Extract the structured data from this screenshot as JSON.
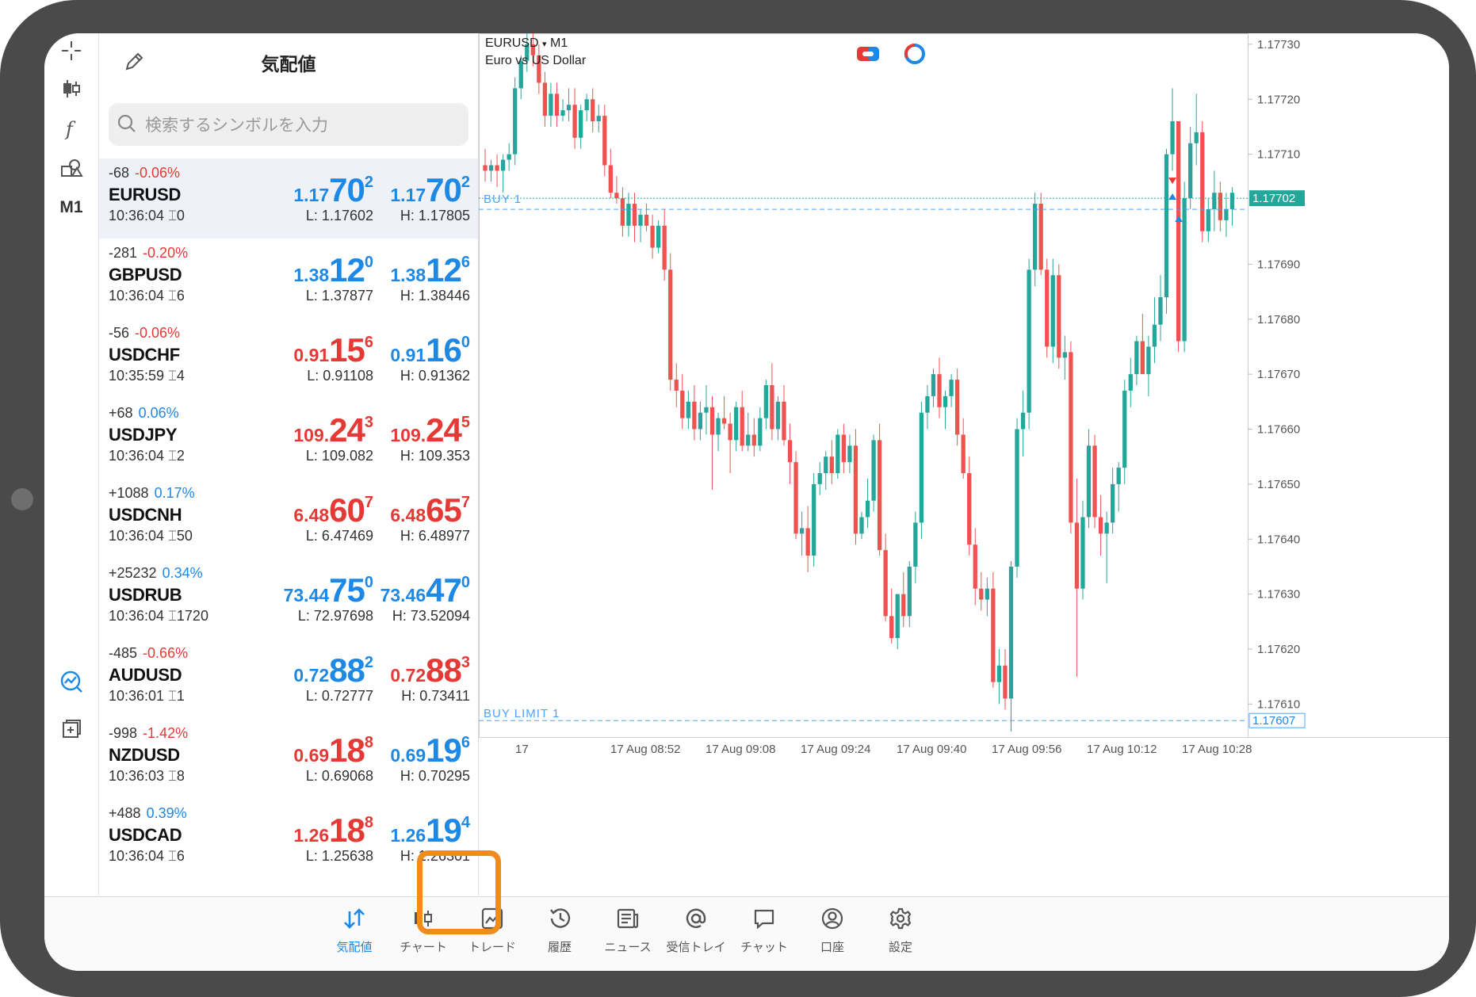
{
  "quotes": {
    "title": "気配値",
    "search_placeholder": "検索するシンボルを入力",
    "rows": [
      {
        "change": "-68",
        "pct": "-0.06%",
        "pct_color": "red",
        "symbol": "EURUSD",
        "time": "10:36:04",
        "spread": "0",
        "bid": {
          "small": "1.17",
          "big": "70",
          "sup": "2",
          "color": "blue"
        },
        "ask": {
          "small": "1.17",
          "big": "70",
          "sup": "2",
          "color": "blue"
        },
        "low": "L: 1.17602",
        "high": "H: 1.17805",
        "selected": true
      },
      {
        "change": "-281",
        "pct": "-0.20%",
        "pct_color": "red",
        "symbol": "GBPUSD",
        "time": "10:36:04",
        "spread": "6",
        "bid": {
          "small": "1.38",
          "big": "12",
          "sup": "0",
          "color": "blue"
        },
        "ask": {
          "small": "1.38",
          "big": "12",
          "sup": "6",
          "color": "blue"
        },
        "low": "L: 1.37877",
        "high": "H: 1.38446",
        "selected": false
      },
      {
        "change": "-56",
        "pct": "-0.06%",
        "pct_color": "red",
        "symbol": "USDCHF",
        "time": "10:35:59",
        "spread": "4",
        "bid": {
          "small": "0.91",
          "big": "15",
          "sup": "6",
          "color": "red"
        },
        "ask": {
          "small": "0.91",
          "big": "16",
          "sup": "0",
          "color": "blue"
        },
        "low": "L: 0.91108",
        "high": "H: 0.91362",
        "selected": false
      },
      {
        "change": "+68",
        "pct": "0.06%",
        "pct_color": "blue",
        "symbol": "USDJPY",
        "time": "10:36:04",
        "spread": "2",
        "bid": {
          "small": "109.",
          "big": "24",
          "sup": "3",
          "color": "red"
        },
        "ask": {
          "small": "109.",
          "big": "24",
          "sup": "5",
          "color": "red"
        },
        "low": "L: 109.082",
        "high": "H: 109.353",
        "selected": false
      },
      {
        "change": "+1088",
        "pct": "0.17%",
        "pct_color": "blue",
        "symbol": "USDCNH",
        "time": "10:36:04",
        "spread": "50",
        "bid": {
          "small": "6.48",
          "big": "60",
          "sup": "7",
          "color": "red"
        },
        "ask": {
          "small": "6.48",
          "big": "65",
          "sup": "7",
          "color": "red"
        },
        "low": "L: 6.47469",
        "high": "H: 6.48977",
        "selected": false
      },
      {
        "change": "+25232",
        "pct": "0.34%",
        "pct_color": "blue",
        "symbol": "USDRUB",
        "time": "10:36:04",
        "spread": "1720",
        "bid": {
          "small": "73.44",
          "big": "75",
          "sup": "0",
          "color": "blue"
        },
        "ask": {
          "small": "73.46",
          "big": "47",
          "sup": "0",
          "color": "blue"
        },
        "low": "L: 72.97698",
        "high": "H: 73.52094",
        "selected": false
      },
      {
        "change": "-485",
        "pct": "-0.66%",
        "pct_color": "red",
        "symbol": "AUDUSD",
        "time": "10:36:01",
        "spread": "1",
        "bid": {
          "small": "0.72",
          "big": "88",
          "sup": "2",
          "color": "blue"
        },
        "ask": {
          "small": "0.72",
          "big": "88",
          "sup": "3",
          "color": "red"
        },
        "low": "L: 0.72777",
        "high": "H: 0.73411",
        "selected": false
      },
      {
        "change": "-998",
        "pct": "-1.42%",
        "pct_color": "red",
        "symbol": "NZDUSD",
        "time": "10:36:03",
        "spread": "8",
        "bid": {
          "small": "0.69",
          "big": "18",
          "sup": "8",
          "color": "red"
        },
        "ask": {
          "small": "0.69",
          "big": "19",
          "sup": "6",
          "color": "blue"
        },
        "low": "L: 0.69068",
        "high": "H: 0.70295",
        "selected": false
      },
      {
        "change": "+488",
        "pct": "0.39%",
        "pct_color": "blue",
        "symbol": "USDCAD",
        "time": "10:36:04",
        "spread": "6",
        "bid": {
          "small": "1.26",
          "big": "18",
          "sup": "8",
          "color": "red"
        },
        "ask": {
          "small": "1.26",
          "big": "19",
          "sup": "4",
          "color": "blue"
        },
        "low": "L: 1.25638",
        "high": "H: 1.26301",
        "selected": false
      }
    ]
  },
  "tools": {
    "timeframe": "M1"
  },
  "chart": {
    "symbol_label": "EURUSD",
    "timeframe": "M1",
    "description": "Euro vs US Dollar",
    "buy_label": "BUY 1",
    "buy_limit_label": "BUY LIMIT 1",
    "current_price_label": "1.17702",
    "buy_limit_price_label": "1.17607"
  },
  "chart_data": {
    "type": "candlestick",
    "y_ticks": [
      "1.17730",
      "1.17720",
      "1.17710",
      "1.17690",
      "1.17680",
      "1.17670",
      "1.17660",
      "1.17650",
      "1.17640",
      "1.17630",
      "1.17620",
      "1.17610"
    ],
    "y_values": [
      1.1773,
      1.1772,
      1.1771,
      1.1769,
      1.1768,
      1.1767,
      1.1766,
      1.1765,
      1.1764,
      1.1763,
      1.1762,
      1.1761
    ],
    "ylim": [
      1.17604,
      1.17732
    ],
    "x_ticks": [
      "17",
      "17 Aug 08:52",
      "17 Aug 09:08",
      "17 Aug 09:24",
      "17 Aug 09:40",
      "17 Aug 09:56",
      "17 Aug 10:12",
      "17 Aug 10:28"
    ],
    "current_price": 1.17702,
    "buy_price": 1.17701,
    "buy_limit_price": 1.17607,
    "up_color": "#26a69a",
    "down_color": "#ef5350",
    "ohlc": [
      [
        1.17708,
        1.17711,
        1.17705,
        1.17707
      ],
      [
        1.17707,
        1.17709,
        1.17705,
        1.17708
      ],
      [
        1.17708,
        1.1771,
        1.17704,
        1.17707
      ],
      [
        1.17707,
        1.1771,
        1.17703,
        1.17709
      ],
      [
        1.17709,
        1.17712,
        1.17707,
        1.1771
      ],
      [
        1.1771,
        1.17724,
        1.17708,
        1.17722
      ],
      [
        1.17722,
        1.17728,
        1.1772,
        1.17727
      ],
      [
        1.17727,
        1.17733,
        1.17725,
        1.1773
      ],
      [
        1.1773,
        1.17733,
        1.17726,
        1.17728
      ],
      [
        1.17728,
        1.1773,
        1.17721,
        1.17723
      ],
      [
        1.17723,
        1.17725,
        1.17715,
        1.17717
      ],
      [
        1.17717,
        1.17723,
        1.17715,
        1.17721
      ],
      [
        1.17721,
        1.17723,
        1.17715,
        1.17717
      ],
      [
        1.17717,
        1.1772,
        1.17716,
        1.17718
      ],
      [
        1.17718,
        1.17722,
        1.17716,
        1.17719
      ],
      [
        1.17719,
        1.17722,
        1.17711,
        1.17713
      ],
      [
        1.17713,
        1.17719,
        1.17711,
        1.17718
      ],
      [
        1.17718,
        1.17721,
        1.17716,
        1.1772
      ],
      [
        1.1772,
        1.17722,
        1.17714,
        1.17716
      ],
      [
        1.17716,
        1.17719,
        1.17714,
        1.17717
      ],
      [
        1.17717,
        1.17719,
        1.17706,
        1.17708
      ],
      [
        1.17708,
        1.17711,
        1.17702,
        1.17703
      ],
      [
        1.17703,
        1.17706,
        1.17701,
        1.17702
      ],
      [
        1.17702,
        1.17704,
        1.17695,
        1.17697
      ],
      [
        1.17697,
        1.17703,
        1.17695,
        1.17701
      ],
      [
        1.17701,
        1.17703,
        1.17694,
        1.17697
      ],
      [
        1.17697,
        1.177,
        1.17694,
        1.17699
      ],
      [
        1.17699,
        1.17701,
        1.17696,
        1.17697
      ],
      [
        1.17697,
        1.17699,
        1.17691,
        1.17693
      ],
      [
        1.17693,
        1.17698,
        1.17692,
        1.17697
      ],
      [
        1.17697,
        1.177,
        1.17687,
        1.17689
      ],
      [
        1.17689,
        1.17692,
        1.17667,
        1.17669
      ],
      [
        1.17669,
        1.17672,
        1.17664,
        1.17667
      ],
      [
        1.17667,
        1.1767,
        1.1766,
        1.17662
      ],
      [
        1.17662,
        1.17667,
        1.1766,
        1.17665
      ],
      [
        1.17665,
        1.17668,
        1.17658,
        1.1766
      ],
      [
        1.1766,
        1.17665,
        1.17658,
        1.17663
      ],
      [
        1.17663,
        1.17668,
        1.17659,
        1.17664
      ],
      [
        1.17664,
        1.17666,
        1.17649,
        1.17659
      ],
      [
        1.17659,
        1.17663,
        1.17656,
        1.17662
      ],
      [
        1.17662,
        1.17666,
        1.1766,
        1.17661
      ],
      [
        1.17661,
        1.17663,
        1.17652,
        1.17658
      ],
      [
        1.17658,
        1.17665,
        1.17656,
        1.17664
      ],
      [
        1.17664,
        1.17667,
        1.17656,
        1.17657
      ],
      [
        1.17657,
        1.17663,
        1.17656,
        1.17659
      ],
      [
        1.17659,
        1.17662,
        1.17655,
        1.17657
      ],
      [
        1.17657,
        1.17664,
        1.17656,
        1.17662
      ],
      [
        1.17662,
        1.17669,
        1.1766,
        1.17668
      ],
      [
        1.17668,
        1.17672,
        1.17658,
        1.1766
      ],
      [
        1.1766,
        1.17666,
        1.17658,
        1.17665
      ],
      [
        1.17665,
        1.17668,
        1.17657,
        1.17658
      ],
      [
        1.17658,
        1.17661,
        1.1765,
        1.17654
      ],
      [
        1.17654,
        1.17656,
        1.1764,
        1.17641
      ],
      [
        1.17641,
        1.17645,
        1.17637,
        1.17642
      ],
      [
        1.17642,
        1.17646,
        1.17634,
        1.17637
      ],
      [
        1.17637,
        1.17652,
        1.17635,
        1.1765
      ],
      [
        1.1765,
        1.17654,
        1.17648,
        1.17652
      ],
      [
        1.17652,
        1.17656,
        1.17649,
        1.17655
      ],
      [
        1.17655,
        1.17658,
        1.1765,
        1.17652
      ],
      [
        1.17652,
        1.1766,
        1.17651,
        1.17659
      ],
      [
        1.17659,
        1.17661,
        1.17652,
        1.17654
      ],
      [
        1.17654,
        1.17659,
        1.17652,
        1.17657
      ],
      [
        1.17657,
        1.1766,
        1.17639,
        1.17641
      ],
      [
        1.17641,
        1.17645,
        1.1764,
        1.17644
      ],
      [
        1.17644,
        1.17651,
        1.17642,
        1.17647
      ],
      [
        1.17647,
        1.17659,
        1.17645,
        1.17658
      ],
      [
        1.17658,
        1.17661,
        1.17637,
        1.17638
      ],
      [
        1.17638,
        1.17641,
        1.17625,
        1.17626
      ],
      [
        1.17626,
        1.17631,
        1.17621,
        1.17622
      ],
      [
        1.17622,
        1.1763,
        1.1762,
        1.1763
      ],
      [
        1.1763,
        1.17634,
        1.17624,
        1.17626
      ],
      [
        1.17626,
        1.17636,
        1.17624,
        1.17635
      ],
      [
        1.17635,
        1.17645,
        1.17632,
        1.17643
      ],
      [
        1.17643,
        1.17665,
        1.1764,
        1.17663
      ],
      [
        1.17663,
        1.17668,
        1.1766,
        1.17666
      ],
      [
        1.17666,
        1.17671,
        1.17664,
        1.1767
      ],
      [
        1.1767,
        1.17673,
        1.17662,
        1.17664
      ],
      [
        1.17664,
        1.17667,
        1.1766,
        1.17666
      ],
      [
        1.17666,
        1.1767,
        1.17664,
        1.17669
      ],
      [
        1.17669,
        1.17671,
        1.17657,
        1.17659
      ],
      [
        1.17659,
        1.17662,
        1.17651,
        1.17652
      ],
      [
        1.17652,
        1.17655,
        1.17637,
        1.17639
      ],
      [
        1.17639,
        1.17642,
        1.17628,
        1.17631
      ],
      [
        1.17631,
        1.17634,
        1.17627,
        1.17629
      ],
      [
        1.17629,
        1.17633,
        1.17626,
        1.17631
      ],
      [
        1.17631,
        1.17634,
        1.17613,
        1.17614
      ],
      [
        1.17614,
        1.1762,
        1.1761,
        1.17617
      ],
      [
        1.17617,
        1.1762,
        1.17609,
        1.17611
      ],
      [
        1.17611,
        1.17636,
        1.17605,
        1.17635
      ],
      [
        1.17635,
        1.17662,
        1.17633,
        1.1766
      ],
      [
        1.1766,
        1.17667,
        1.17655,
        1.17663
      ],
      [
        1.17663,
        1.17691,
        1.1766,
        1.17689
      ],
      [
        1.17689,
        1.17703,
        1.17686,
        1.17701
      ],
      [
        1.17701,
        1.17703,
        1.17688,
        1.17689
      ],
      [
        1.17689,
        1.17691,
        1.17673,
        1.17675
      ],
      [
        1.17675,
        1.17691,
        1.17672,
        1.17688
      ],
      [
        1.17688,
        1.1769,
        1.17671,
        1.17673
      ],
      [
        1.17673,
        1.17677,
        1.17669,
        1.17674
      ],
      [
        1.17674,
        1.17676,
        1.17641,
        1.17643
      ],
      [
        1.17643,
        1.17651,
        1.17615,
        1.17631
      ],
      [
        1.17631,
        1.17647,
        1.17629,
        1.17644
      ],
      [
        1.17644,
        1.1766,
        1.17642,
        1.17657
      ],
      [
        1.17657,
        1.17659,
        1.17642,
        1.17644
      ],
      [
        1.17644,
        1.17648,
        1.17637,
        1.17641
      ],
      [
        1.17641,
        1.17645,
        1.17632,
        1.17643
      ],
      [
        1.17643,
        1.17653,
        1.17641,
        1.1765
      ],
      [
        1.1765,
        1.17654,
        1.17645,
        1.17653
      ],
      [
        1.17653,
        1.17669,
        1.1765,
        1.17667
      ],
      [
        1.17667,
        1.17673,
        1.17664,
        1.1767
      ],
      [
        1.1767,
        1.17677,
        1.17668,
        1.17676
      ],
      [
        1.17676,
        1.17681,
        1.17673,
        1.1767
      ],
      [
        1.1767,
        1.17677,
        1.17666,
        1.17675
      ],
      [
        1.17675,
        1.17684,
        1.17672,
        1.17679
      ],
      [
        1.17679,
        1.17688,
        1.17676,
        1.17684
      ],
      [
        1.17684,
        1.17711,
        1.17681,
        1.1771
      ],
      [
        1.1771,
        1.17722,
        1.17707,
        1.17716
      ],
      [
        1.17716,
        1.17714,
        1.17674,
        1.17676
      ],
      [
        1.17676,
        1.17705,
        1.17674,
        1.17702
      ],
      [
        1.17702,
        1.17715,
        1.177,
        1.17712
      ],
      [
        1.17712,
        1.17721,
        1.17708,
        1.17714
      ],
      [
        1.17714,
        1.17716,
        1.17694,
        1.17696
      ],
      [
        1.17696,
        1.17702,
        1.17694,
        1.177
      ],
      [
        1.177,
        1.17707,
        1.17696,
        1.17703
      ],
      [
        1.17703,
        1.17705,
        1.17696,
        1.17698
      ],
      [
        1.17698,
        1.17703,
        1.17695,
        1.177
      ],
      [
        1.177,
        1.17704,
        1.17697,
        1.17703
      ]
    ]
  },
  "tabs": [
    {
      "label": "気配値",
      "icon": "quotes-arrows-icon",
      "active": true
    },
    {
      "label": "チャート",
      "icon": "candles-icon",
      "active": false
    },
    {
      "label": "トレード",
      "icon": "trade-chart-icon",
      "active": false
    },
    {
      "label": "履歴",
      "icon": "history-clock-icon",
      "active": false
    },
    {
      "label": "ニュース",
      "icon": "news-icon",
      "active": false
    },
    {
      "label": "受信トレイ",
      "icon": "at-icon",
      "active": false
    },
    {
      "label": "チャット",
      "icon": "chat-bubble-icon",
      "active": false
    },
    {
      "label": "口座",
      "icon": "account-icon",
      "active": false
    },
    {
      "label": "設定",
      "icon": "gear-icon",
      "active": false
    }
  ],
  "colors": {
    "blue": "#1e88e5",
    "red": "#e53935",
    "highlight": "#f08c1c"
  }
}
